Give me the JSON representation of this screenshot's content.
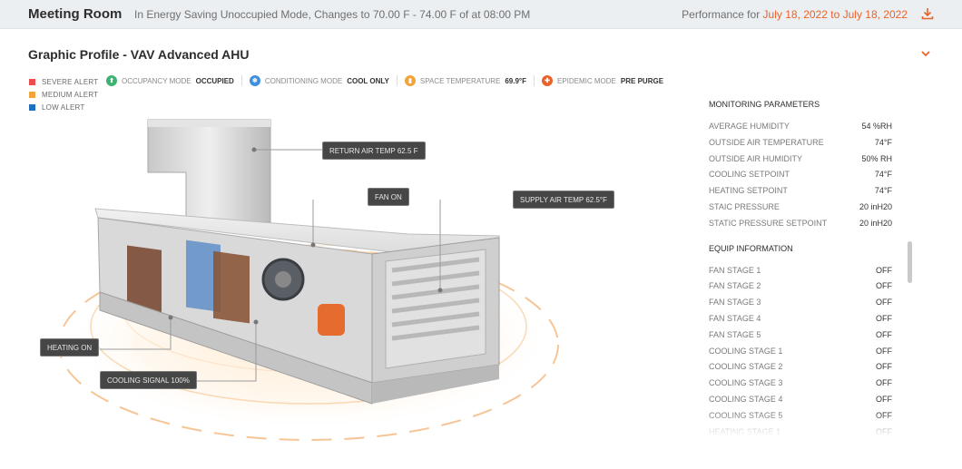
{
  "header": {
    "room": "Meeting Room",
    "status": "In Energy Saving Unoccupied Mode, Changes  to 70.00 F - 74.00 F of at 08:00 PM",
    "performance_label": "Performance for",
    "date_range": "July 18, 2022 to July 18, 2022",
    "download_icon": "download-icon"
  },
  "profile": {
    "title": "Graphic Profile - VAV Advanced AHU",
    "collapse_icon": "chevron-down-icon"
  },
  "legend": [
    {
      "label": "SEVERE ALERT",
      "color": "#ef4d4d"
    },
    {
      "label": "MEDIUM ALERT",
      "color": "#f4a43a"
    },
    {
      "label": "LOW ALERT",
      "color": "#1f6fbf"
    }
  ],
  "modes": [
    {
      "label": "OCCUPANCY MODE",
      "value": "OCCUPIED",
      "color": "#3cb371",
      "icon": "occupancy-icon"
    },
    {
      "label": "CONDITIONING MODE",
      "value": "COOL ONLY",
      "color": "#3d8fe0",
      "icon": "conditioning-icon"
    },
    {
      "label": "SPACE TEMPERATURE",
      "value": "69.9°F",
      "color": "#f2a33a",
      "icon": "temperature-icon"
    },
    {
      "label": "EPIDEMIC MODE",
      "value": "PRE PURGE",
      "color": "#e8622a",
      "icon": "shield-icon"
    }
  ],
  "callouts": {
    "return_air": "RETURN AIR TEMP  62.5 F",
    "fan": "FAN  ON",
    "supply_air": "SUPPLY AIR TEMP  62.5°F",
    "heating": "HEATING  ON",
    "cooling": "COOLING SIGNAL 100%"
  },
  "monitoring": {
    "title": "MONITORING PARAMETERS",
    "rows": [
      {
        "label": "AVERAGE HUMIDITY",
        "value": "54 %RH"
      },
      {
        "label": "OUTSIDE AIR TEMPERATURE",
        "value": "74°F"
      },
      {
        "label": "OUTSIDE AIR HUMIDITY",
        "value": "50% RH"
      },
      {
        "label": "COOLING SETPOINT",
        "value": "74°F"
      },
      {
        "label": "HEATING SETPOINT",
        "value": "74°F"
      },
      {
        "label": "STAIC PRESSURE",
        "value": "20 inH20"
      },
      {
        "label": "STATIC PRESSURE SETPOINT",
        "value": "20 inH20"
      }
    ]
  },
  "equip": {
    "title": "EQUIP INFORMATION",
    "rows": [
      {
        "label": "FAN STAGE 1",
        "value": "OFF"
      },
      {
        "label": "FAN STAGE 2",
        "value": "OFF"
      },
      {
        "label": "FAN STAGE 3",
        "value": "OFF"
      },
      {
        "label": "FAN STAGE 4",
        "value": "OFF"
      },
      {
        "label": "FAN STAGE 5",
        "value": "OFF"
      },
      {
        "label": "COOLING STAGE 1",
        "value": "OFF"
      },
      {
        "label": "COOLING STAGE 2",
        "value": "OFF"
      },
      {
        "label": "COOLING STAGE 3",
        "value": "OFF"
      },
      {
        "label": "COOLING STAGE 4",
        "value": "OFF"
      },
      {
        "label": "COOLING STAGE 5",
        "value": "OFF"
      },
      {
        "label": "HEATING STAGE 1",
        "value": "OFF"
      }
    ]
  }
}
